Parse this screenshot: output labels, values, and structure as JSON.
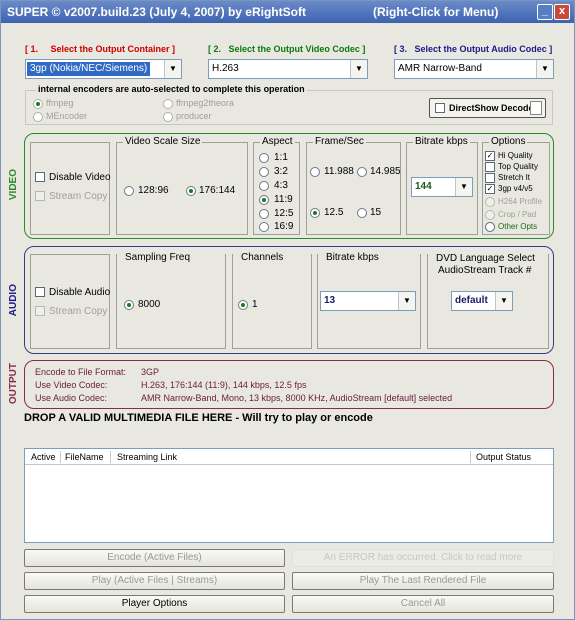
{
  "titlebar": {
    "title": "SUPER © v2007.build.23 (July 4, 2007) by eRightSoft",
    "right_click": "(Right-Click for Menu)",
    "minimize": "_",
    "close": "x"
  },
  "headers": {
    "container": {
      "num": "[ 1.",
      "label": "Select the Output Container ]"
    },
    "video_codec": {
      "num": "[ 2.",
      "label": "Select the Output Video Codec ]"
    },
    "audio_codec": {
      "num": "[ 3.",
      "label": "Select the Output Audio Codec ]"
    }
  },
  "combos": {
    "container": "3gp  (Nokia/NEC/Siemens)",
    "video_codec": "H.263",
    "audio_codec": "AMR Narrow-Band"
  },
  "encoders": {
    "caption": "internal encoders are auto-selected to complete this operation",
    "ffmpeg": "ffmpeg",
    "mencoder": "MEncoder",
    "ffmpeg2theora": "ffmpeg2theora",
    "producer": "producer",
    "directshow": "DirectShow Decode"
  },
  "video": {
    "section_label": "VIDEO",
    "disable": "Disable Video",
    "stream_copy": "Stream Copy",
    "scale_title": "Video Scale Size",
    "scale_opts": [
      "128:96",
      "176:144"
    ],
    "scale_selected": "176:144",
    "aspect_title": "Aspect",
    "aspect_opts": [
      "1:1",
      "3:2",
      "4:3",
      "11:9",
      "12:5",
      "16:9"
    ],
    "aspect_selected": "11:9",
    "fps_title": "Frame/Sec",
    "fps_opts": [
      "11.988",
      "14.985",
      "12.5",
      "15"
    ],
    "fps_selected": "12.5",
    "bitrate_title": "Bitrate  kbps",
    "bitrate_value": "144",
    "options_title": "Options",
    "options": [
      {
        "label": "Hi Quality",
        "checked": true,
        "disabled": false
      },
      {
        "label": "Top Quality",
        "checked": false,
        "disabled": false
      },
      {
        "label": "Stretch It",
        "checked": false,
        "disabled": false
      },
      {
        "label": "3gp  v4/v5",
        "checked": true,
        "disabled": false
      },
      {
        "label": "H264 Profile",
        "checked": false,
        "disabled": true
      },
      {
        "label": "Crop / Pad",
        "checked": false,
        "disabled": true
      },
      {
        "label": "Other Opts",
        "checked": false,
        "disabled": false
      }
    ]
  },
  "audio": {
    "section_label": "AUDIO",
    "disable": "Disable Audio",
    "stream_copy": "Stream Copy",
    "freq_title": "Sampling Freq",
    "freq_value": "8000",
    "channels_title": "Channels",
    "channels_value": "1",
    "bitrate_title": "Bitrate  kbps",
    "bitrate_value": "13",
    "dvd_title": "DVD Language Select",
    "dvd_subtitle": "AudioStream  Track #",
    "dvd_value": "default"
  },
  "output": {
    "section_label": "OUTPUT",
    "rows": [
      {
        "label": "Encode to File Format:",
        "value": "3GP"
      },
      {
        "label": "Use Video Codec:",
        "value": "H.263,  176:144 (11:9),  144 kbps,  12.5 fps"
      },
      {
        "label": "Use Audio Codec:",
        "value": "AMR Narrow-Band,  Mono,  13 kbps,  8000 KHz,  AudioStream [default] selected"
      }
    ]
  },
  "drop_text": "DROP A VALID MULTIMEDIA FILE HERE - Will try to play or encode",
  "filelist": {
    "columns": [
      "Active",
      "FileName",
      "Streaming Link",
      "Output Status"
    ]
  },
  "buttons": {
    "encode": "Encode (Active Files)",
    "error": "An ERROR has occurred. Click to read more",
    "play": "Play (Active Files | Streams)",
    "play_last": "Play The Last Rendered File",
    "player_options": "Player Options",
    "cancel": "Cancel All"
  },
  "colors": {
    "video_border": "#2a8a2a",
    "audio_border": "#3a3a8a",
    "output_border": "#8a2a4a",
    "title_bar": "#3d63b0"
  }
}
